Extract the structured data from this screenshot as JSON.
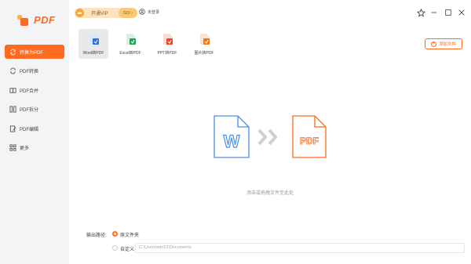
{
  "app": {
    "logo_text": "PDF"
  },
  "sidebar": {
    "items": [
      {
        "label": "转换为PDF",
        "active": true
      },
      {
        "label": "PDF转换"
      },
      {
        "label": "PDF合并"
      },
      {
        "label": "PDF拆分"
      },
      {
        "label": "PDF编辑"
      },
      {
        "label": "更多"
      }
    ]
  },
  "topbar": {
    "vip_label": "开通VIP",
    "vip_go": "GO",
    "login_label": "未登录"
  },
  "tools": [
    {
      "label": "Word转PDF",
      "color": "#2f6fd6",
      "active": true
    },
    {
      "label": "Excel转PDF",
      "color": "#1fa55b"
    },
    {
      "label": "PPT转PDF",
      "color": "#e8492c"
    },
    {
      "label": "图片转PDF",
      "color": "#f07a1a"
    }
  ],
  "add_file_label": "添加文件",
  "drop": {
    "word_glyph": "W",
    "pdf_glyph": "PDF",
    "hint": "添击或拖拽文件至此处"
  },
  "output": {
    "label": "输出路径:",
    "source_folder_label": "原文件夹",
    "custom_label": "自定义",
    "path_value": "C:\\Users\\win10\\Documents"
  },
  "colors": {
    "accent": "#ff6a1f",
    "word_blue": "#4a8fe0",
    "pdf_orange": "#ff6a1f"
  }
}
